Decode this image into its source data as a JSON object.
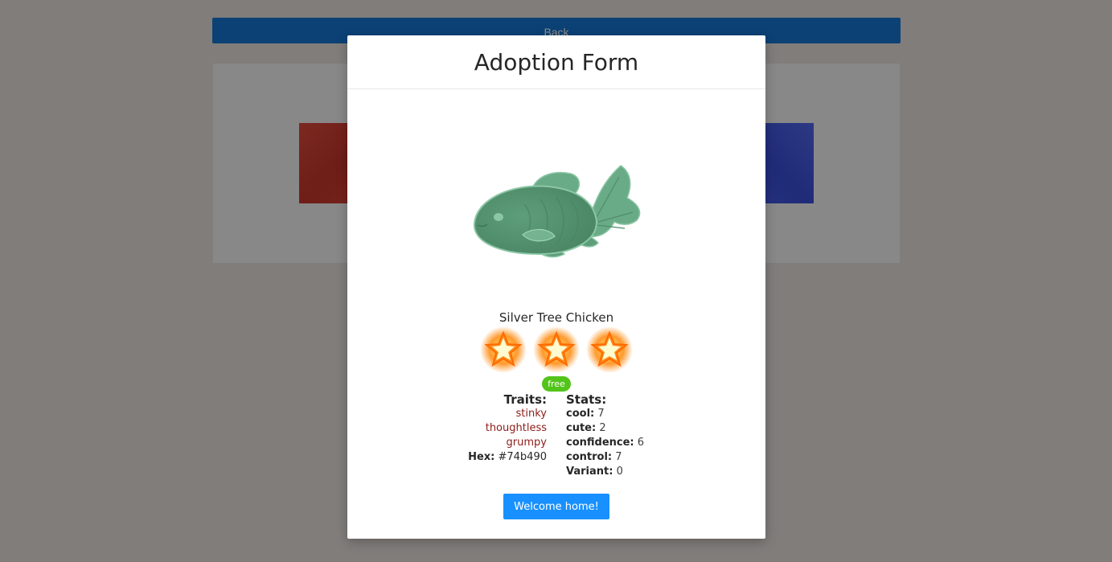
{
  "background": {
    "back_label": "Back"
  },
  "modal": {
    "title": "Adoption Form",
    "pet_name": "Silver Tree Chicken",
    "rating": 3,
    "badge": "free",
    "traits_heading": "Traits:",
    "traits": [
      "stinky",
      "thoughtless",
      "grumpy"
    ],
    "hex_label": "Hex:",
    "hex_value": "#74b490",
    "stats_heading": "Stats:",
    "stats": [
      {
        "label": "cool:",
        "value": "7"
      },
      {
        "label": "cute:",
        "value": "2"
      },
      {
        "label": "confidence:",
        "value": "6"
      },
      {
        "label": "control:",
        "value": "7"
      },
      {
        "label": "Variant:",
        "value": "0"
      }
    ],
    "welcome_label": "Welcome home!"
  },
  "colors": {
    "primary": "#1890ff",
    "badge_green": "#52c41a",
    "trait_red": "#8c1d18",
    "pet_color": "#74b490"
  },
  "icons": {
    "pet": "fish-image",
    "rating": "star-icon"
  }
}
